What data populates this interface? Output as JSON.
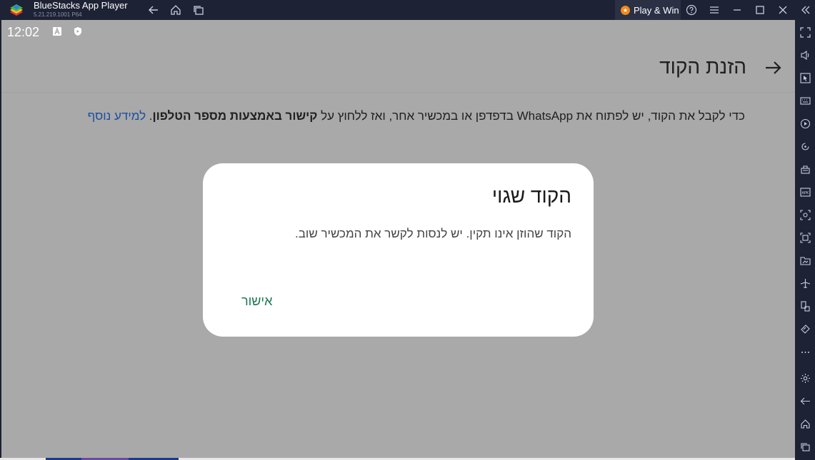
{
  "titlebar": {
    "app_name": "BlueStacks App Player",
    "version": "5.21.219.1001 P64",
    "play_win": "Play & Win"
  },
  "status_bar": {
    "time": "12:02"
  },
  "appbar": {
    "title": "הזנת הקוד"
  },
  "info": {
    "text_before_bold": "כדי לקבל את הקוד, יש לפתוח את WhatsApp בדפדפן או במכשיר אחר, ואז ללחוץ על ",
    "bold_text": "קישור באמצעות מספר הטלפון",
    "text_after_bold": ". ",
    "link_text": "למידע נוסף"
  },
  "dialog": {
    "title": "הקוד שגוי",
    "message": "הקוד שהוזן אינו תקין. יש לנסות לקשר את המכשיר שוב.",
    "confirm_label": "אישור"
  },
  "colors": {
    "accent_green": "#1d7a4f",
    "link_blue": "#1a4fa0",
    "chrome_dark": "#1e2235"
  }
}
